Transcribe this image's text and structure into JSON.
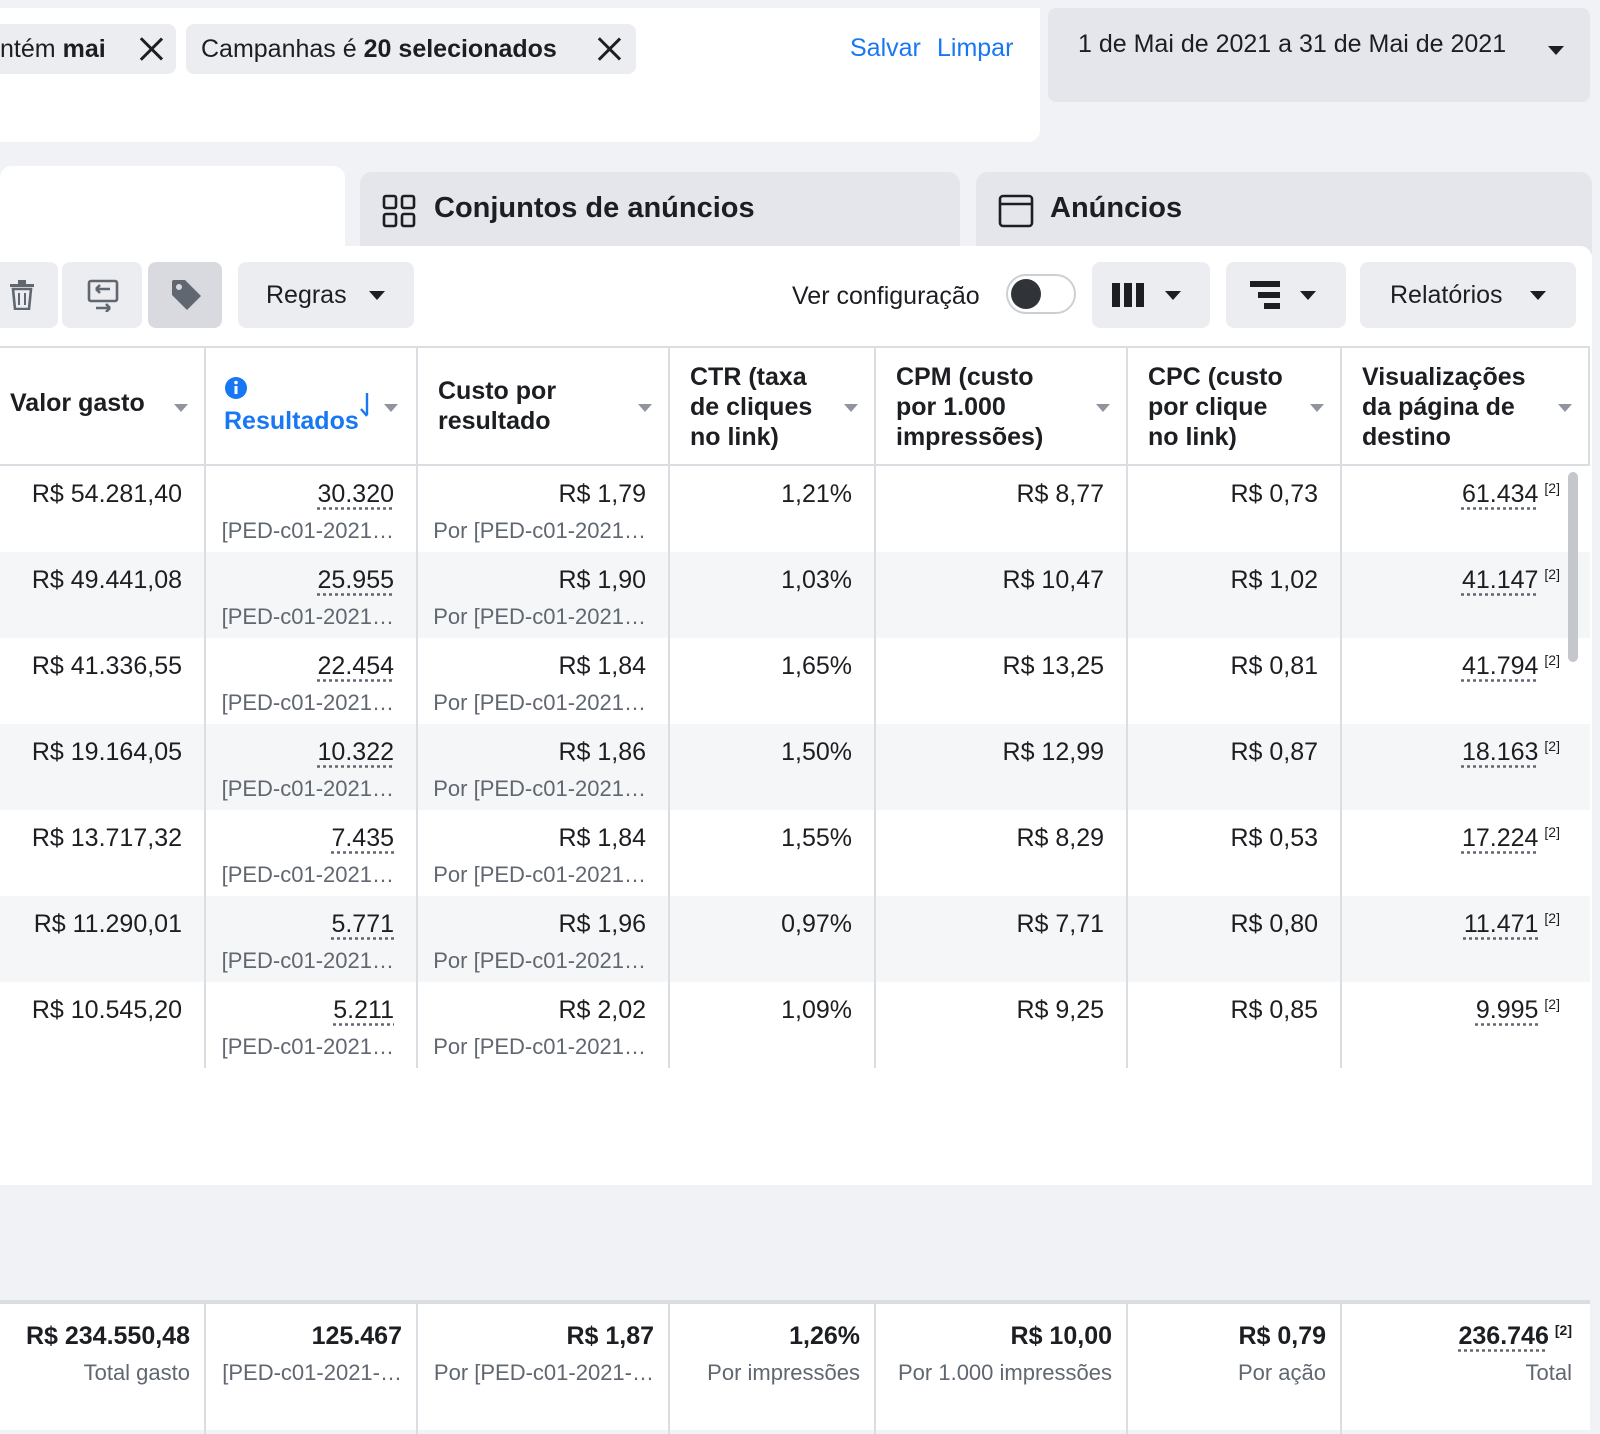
{
  "filters": {
    "chip1": {
      "prefix": "ntém",
      "bold": "mai"
    },
    "chip2": {
      "prefix": "Campanhas é",
      "bold": "20 selecionados"
    },
    "save": "Salvar",
    "clear": "Limpar",
    "date_range": "1 de Mai de 2021 a 31 de Mai de 2021"
  },
  "tabs": [
    {
      "label": "Conjuntos de anúncios",
      "icon": "grid-icon"
    },
    {
      "label": "Anúncios",
      "icon": "window-icon"
    }
  ],
  "toolbar": {
    "rules": "Regras",
    "view_config": "Ver configuração",
    "reports": "Relatórios"
  },
  "table": {
    "columns": [
      "Valor gasto",
      "Resultados",
      "Custo por\nresultado",
      "CTR (taxa\nde cliques\nno link)",
      "CPM (custo\npor 1.000\nimpressões)",
      "CPC (custo\npor clique\nno link)",
      "Visualizações\nda página de\ndestino"
    ],
    "rows": [
      {
        "spend": "R$ 54.281,40",
        "results": "30.320",
        "results_sub": "[PED-c01-2021…",
        "cpr": "R$ 1,79",
        "cpr_sub": "Por [PED-c01-2021…",
        "ctr": "1,21%",
        "cpm": "R$ 8,77",
        "cpc": "R$ 0,73",
        "lpv": "61.434",
        "lpv_note": "[2]"
      },
      {
        "spend": "R$ 49.441,08",
        "results": "25.955",
        "results_sub": "[PED-c01-2021…",
        "cpr": "R$ 1,90",
        "cpr_sub": "Por [PED-c01-2021…",
        "ctr": "1,03%",
        "cpm": "R$ 10,47",
        "cpc": "R$ 1,02",
        "lpv": "41.147",
        "lpv_note": "[2]"
      },
      {
        "spend": "R$ 41.336,55",
        "results": "22.454",
        "results_sub": "[PED-c01-2021…",
        "cpr": "R$ 1,84",
        "cpr_sub": "Por [PED-c01-2021…",
        "ctr": "1,65%",
        "cpm": "R$ 13,25",
        "cpc": "R$ 0,81",
        "lpv": "41.794",
        "lpv_note": "[2]"
      },
      {
        "spend": "R$ 19.164,05",
        "results": "10.322",
        "results_sub": "[PED-c01-2021…",
        "cpr": "R$ 1,86",
        "cpr_sub": "Por [PED-c01-2021…",
        "ctr": "1,50%",
        "cpm": "R$ 12,99",
        "cpc": "R$ 0,87",
        "lpv": "18.163",
        "lpv_note": "[2]"
      },
      {
        "spend": "R$ 13.717,32",
        "results": "7.435",
        "results_sub": "[PED-c01-2021…",
        "cpr": "R$ 1,84",
        "cpr_sub": "Por [PED-c01-2021…",
        "ctr": "1,55%",
        "cpm": "R$ 8,29",
        "cpc": "R$ 0,53",
        "lpv": "17.224",
        "lpv_note": "[2]"
      },
      {
        "spend": "R$ 11.290,01",
        "results": "5.771",
        "results_sub": "[PED-c01-2021…",
        "cpr": "R$ 1,96",
        "cpr_sub": "Por [PED-c01-2021…",
        "ctr": "0,97%",
        "cpm": "R$ 7,71",
        "cpc": "R$ 0,80",
        "lpv": "11.471",
        "lpv_note": "[2]"
      },
      {
        "spend": "R$ 10.545,20",
        "results": "5.211",
        "results_sub": "[PED-c01-2021…",
        "cpr": "R$ 2,02",
        "cpr_sub": "Por [PED-c01-2021…",
        "ctr": "1,09%",
        "cpm": "R$ 9,25",
        "cpc": "R$ 0,85",
        "lpv": "9.995",
        "lpv_note": "[2]"
      }
    ],
    "totals": {
      "spend": "R$ 234.550,48",
      "spend_sub": "Total gasto",
      "results": "125.467",
      "results_sub": "[PED-c01-2021-…",
      "cpr": "R$ 1,87",
      "cpr_sub": "Por [PED-c01-2021-…",
      "ctr": "1,26%",
      "ctr_sub": "Por impressões",
      "cpm": "R$ 10,00",
      "cpm_sub": "Por 1.000 impressões",
      "cpc": "R$ 0,79",
      "cpc_sub": "Por ação",
      "lpv": "236.746",
      "lpv_note": "[2]",
      "lpv_sub": "Total"
    }
  },
  "colors": {
    "accent": "#1877f2",
    "alt_row": "#f5f6f7",
    "border": "#dadde1"
  }
}
